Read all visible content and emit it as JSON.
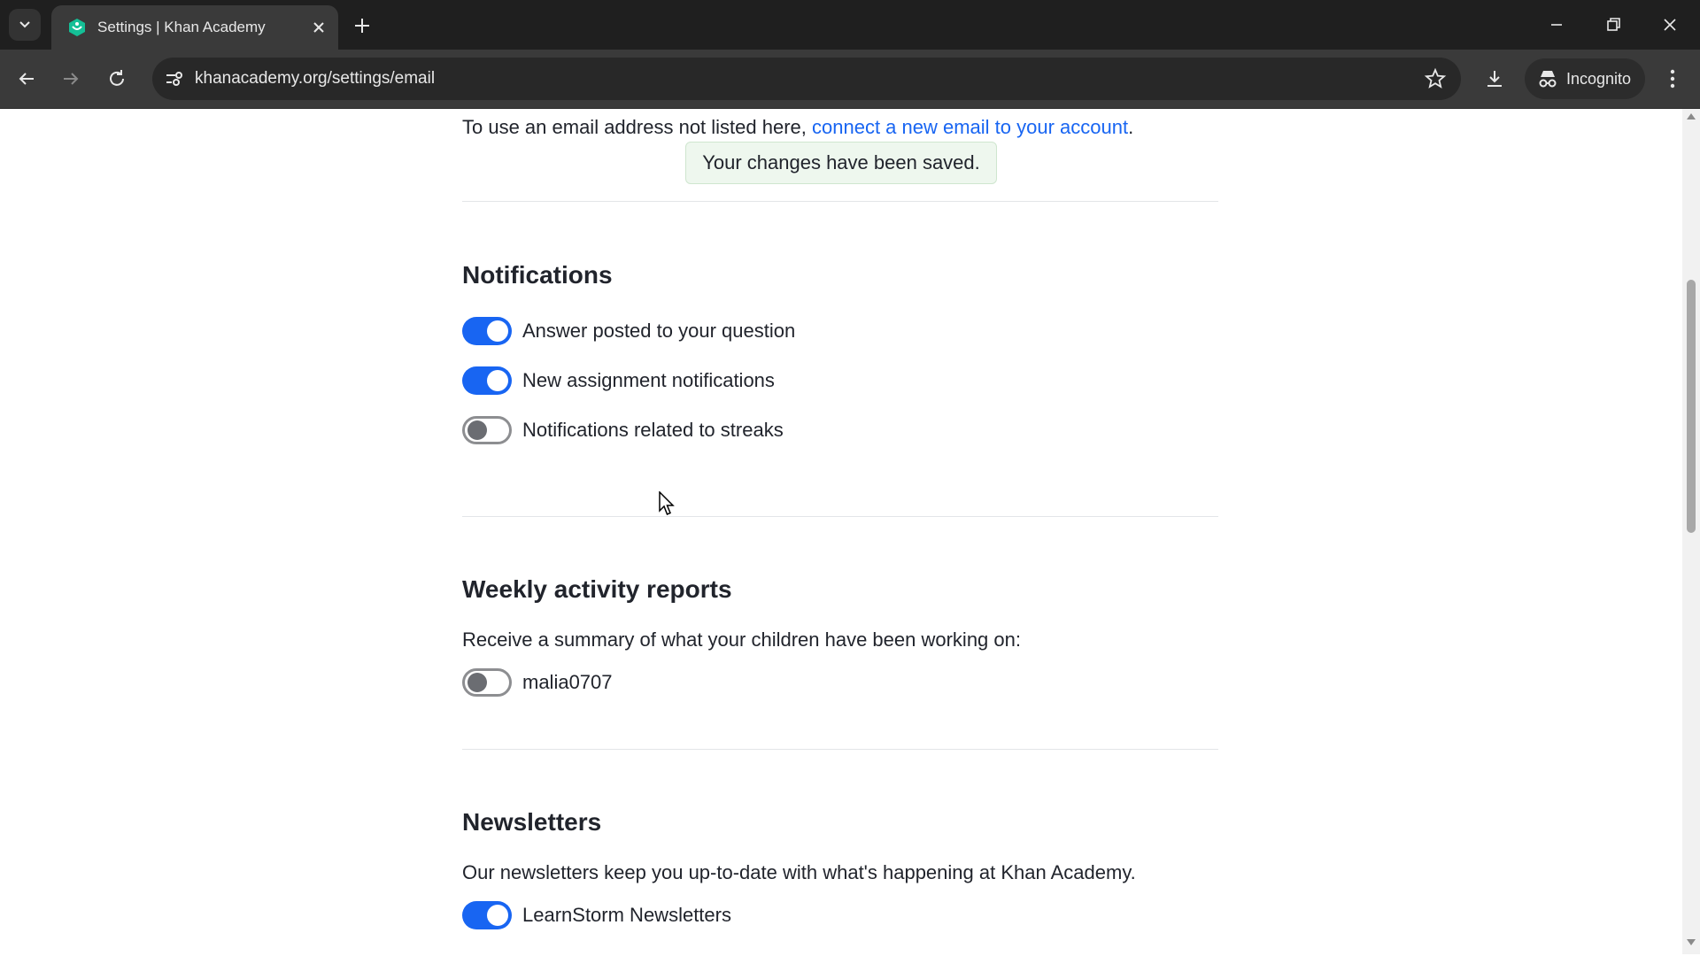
{
  "browser": {
    "tab_title": "Settings | Khan Academy",
    "url": "khanacademy.org/settings/email",
    "incognito_label": "Incognito"
  },
  "email": {
    "note_prefix": "To use an email address not listed here, ",
    "note_link": "connect a new email to your account",
    "note_suffix": ".",
    "toast": "Your changes have been saved."
  },
  "notifications": {
    "title": "Notifications",
    "items": [
      {
        "label": "Answer posted to your question",
        "enabled": true
      },
      {
        "label": "New assignment notifications",
        "enabled": true
      },
      {
        "label": "Notifications related to streaks",
        "enabled": false
      }
    ]
  },
  "weekly": {
    "title": "Weekly activity reports",
    "description": "Receive a summary of what your children have been working on:",
    "items": [
      {
        "label": "malia0707",
        "enabled": false
      }
    ]
  },
  "newsletters": {
    "title": "Newsletters",
    "description": "Our newsletters keep you up-to-date with what's happening at Khan Academy.",
    "items": [
      {
        "label": "LearnStorm Newsletters",
        "enabled": true
      }
    ]
  },
  "colors": {
    "accent": "#1865f2",
    "toggle_off": "#8d8e91",
    "toast_bg": "#eef7ee"
  }
}
